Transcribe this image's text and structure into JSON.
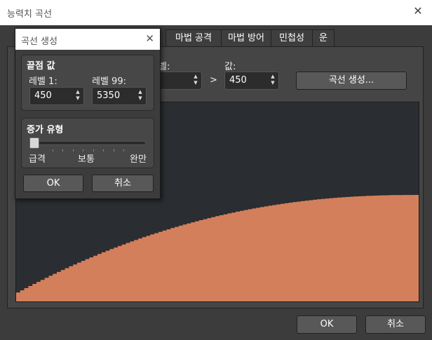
{
  "window": {
    "title": "능력치 곡선",
    "close_glyph": "✕"
  },
  "tabs": [
    {
      "label": "마법 공격"
    },
    {
      "label": "마법 방어"
    },
    {
      "label": "민첩성"
    },
    {
      "label": "운"
    }
  ],
  "range": {
    "level_label_fragment": "벨:",
    "separator": ">",
    "value_label": "값:",
    "value": "450",
    "generate_button": "곡선 생성..."
  },
  "popup": {
    "title": "곡선 생성",
    "close_glyph": "✕",
    "endpoints": {
      "title": "끝점 값",
      "level1_label": "레벨 1:",
      "level1_value": "450",
      "level99_label": "레벨 99:",
      "level99_value": "5350"
    },
    "growth": {
      "title": "증가 유형",
      "slider_position": 0,
      "left_label": "급격",
      "middle_label": "보통",
      "right_label": "완만"
    },
    "ok": "OK",
    "cancel": "취소"
  },
  "footer": {
    "ok": "OK",
    "cancel": "취소"
  },
  "curve": {
    "color": "#d47f5c",
    "start_value": 450,
    "end_value": 5350,
    "max_value": 9999,
    "levels": 99
  }
}
